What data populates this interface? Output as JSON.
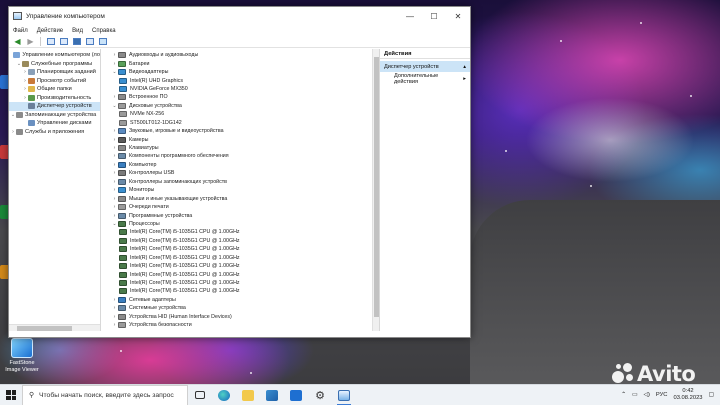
{
  "window": {
    "title": "Управление компьютером",
    "controls": {
      "minimize": "—",
      "maximize": "☐",
      "close": "✕"
    }
  },
  "menu": [
    "Файл",
    "Действие",
    "Вид",
    "Справка"
  ],
  "left_tree": [
    {
      "label": "Управление компьютером (ло",
      "chev": "",
      "color": "#7aa4d8",
      "indent": 0,
      "selected": false
    },
    {
      "label": "Служебные программы",
      "chev": "⌄",
      "color": "#9a8b5c",
      "indent": 1,
      "selected": false
    },
    {
      "label": "Планировщик заданий",
      "chev": "›",
      "color": "#8aa0b8",
      "indent": 2,
      "selected": false
    },
    {
      "label": "Просмотр событий",
      "chev": "›",
      "color": "#c97a3a",
      "indent": 2,
      "selected": false
    },
    {
      "label": "Общие папки",
      "chev": "›",
      "color": "#e0b84c",
      "indent": 2,
      "selected": false
    },
    {
      "label": "Производительность",
      "chev": "›",
      "color": "#5a9a4c",
      "indent": 2,
      "selected": false
    },
    {
      "label": "Диспетчер устройств",
      "chev": "",
      "color": "#6a7f9a",
      "indent": 2,
      "selected": true
    },
    {
      "label": "Запоминающие устройства",
      "chev": "⌄",
      "color": "#8b8b8b",
      "indent": 0,
      "selected": false
    },
    {
      "label": "Управление дисками",
      "chev": "",
      "color": "#6a90c0",
      "indent": 2,
      "selected": false
    },
    {
      "label": "Службы и приложения",
      "chev": "›",
      "color": "#8a8a8a",
      "indent": 0,
      "selected": false
    }
  ],
  "device_tree": [
    {
      "label": "Аудиовходы и аудиовыходы",
      "chev": "›",
      "color": "#8a8a8a",
      "child": false
    },
    {
      "label": "Батареи",
      "chev": "›",
      "color": "#5aa05a",
      "child": false
    },
    {
      "label": "Видеоадаптеры",
      "chev": "⌄",
      "color": "#3a8fd0",
      "child": false
    },
    {
      "label": "Intel(R) UHD Graphics",
      "chev": "",
      "color": "#3a8fd0",
      "child": true
    },
    {
      "label": "NVIDIA GeForce MX350",
      "chev": "",
      "color": "#3a8fd0",
      "child": true
    },
    {
      "label": "Встроенное ПО",
      "chev": "›",
      "color": "#8a8a8a",
      "child": false
    },
    {
      "label": "Дисковые устройства",
      "chev": "⌄",
      "color": "#9a9a9a",
      "child": false
    },
    {
      "label": "NVMe NX-256",
      "chev": "",
      "color": "#9a9a9a",
      "child": true
    },
    {
      "label": "ST500LT012-1DG142",
      "chev": "",
      "color": "#9a9a9a",
      "child": true
    },
    {
      "label": "Звуковые, игровые и видеоустройства",
      "chev": "›",
      "color": "#5a8ac0",
      "child": false
    },
    {
      "label": "Камеры",
      "chev": "›",
      "color": "#5a5a5a",
      "child": false
    },
    {
      "label": "Клавиатуры",
      "chev": "›",
      "color": "#8a8a8a",
      "child": false
    },
    {
      "label": "Компоненты программного обеспечения",
      "chev": "›",
      "color": "#6a8aa8",
      "child": false
    },
    {
      "label": "Компьютер",
      "chev": "›",
      "color": "#3a7fc0",
      "child": false
    },
    {
      "label": "Контроллеры USB",
      "chev": "›",
      "color": "#7a7a7a",
      "child": false
    },
    {
      "label": "Контроллеры запоминающих устройств",
      "chev": "›",
      "color": "#6a8aa8",
      "child": false
    },
    {
      "label": "Мониторы",
      "chev": "›",
      "color": "#3a8fd0",
      "child": false
    },
    {
      "label": "Мыши и иные указывающие устройства",
      "chev": "›",
      "color": "#8a8a8a",
      "child": false
    },
    {
      "label": "Очереди печати",
      "chev": "›",
      "color": "#9a9a9a",
      "child": false
    },
    {
      "label": "Программные устройства",
      "chev": "›",
      "color": "#6a8aa8",
      "child": false
    },
    {
      "label": "Процессоры",
      "chev": "⌄",
      "color": "#4a7a4a",
      "child": false
    },
    {
      "label": "Intel(R) Core(TM) i5-1035G1 CPU @ 1.00GHz",
      "chev": "",
      "color": "#4a7a4a",
      "child": true
    },
    {
      "label": "Intel(R) Core(TM) i5-1035G1 CPU @ 1.00GHz",
      "chev": "",
      "color": "#4a7a4a",
      "child": true
    },
    {
      "label": "Intel(R) Core(TM) i5-1035G1 CPU @ 1.00GHz",
      "chev": "",
      "color": "#4a7a4a",
      "child": true
    },
    {
      "label": "Intel(R) Core(TM) i5-1035G1 CPU @ 1.00GHz",
      "chev": "",
      "color": "#4a7a4a",
      "child": true
    },
    {
      "label": "Intel(R) Core(TM) i5-1035G1 CPU @ 1.00GHz",
      "chev": "",
      "color": "#4a7a4a",
      "child": true
    },
    {
      "label": "Intel(R) Core(TM) i5-1035G1 CPU @ 1.00GHz",
      "chev": "",
      "color": "#4a7a4a",
      "child": true
    },
    {
      "label": "Intel(R) Core(TM) i5-1035G1 CPU @ 1.00GHz",
      "chev": "",
      "color": "#4a7a4a",
      "child": true
    },
    {
      "label": "Intel(R) Core(TM) i5-1035G1 CPU @ 1.00GHz",
      "chev": "",
      "color": "#4a7a4a",
      "child": true
    },
    {
      "label": "Сетевые адаптеры",
      "chev": "›",
      "color": "#3a7fc0",
      "child": false
    },
    {
      "label": "Системные устройства",
      "chev": "›",
      "color": "#6a8aa8",
      "child": false
    },
    {
      "label": "Устройства HID (Human Interface Devices)",
      "chev": "›",
      "color": "#8a8a8a",
      "child": false
    },
    {
      "label": "Устройства безопасности",
      "chev": "›",
      "color": "#9a9a9a",
      "child": false
    }
  ],
  "actions": {
    "header": "Действия",
    "selected": "Диспетчер устройств",
    "more": "Дополнительные действия"
  },
  "desktop": {
    "icon_label_1": "FastStone",
    "icon_label_2": "Image Viewer"
  },
  "taskbar": {
    "search_placeholder": "Чтобы начать поиск, введите здесь запрос",
    "language": "РУС",
    "time": "0:42",
    "date": "03.08.2023"
  },
  "watermark": "Avito"
}
